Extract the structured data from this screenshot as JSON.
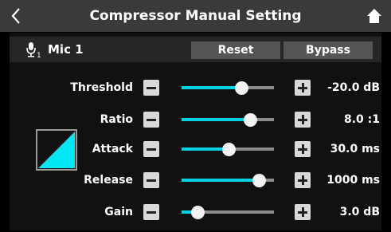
{
  "header": {
    "title": "Compressor Manual Setting",
    "back_icon": "chevron-left-icon",
    "home_icon": "home-icon"
  },
  "channel": {
    "icon": "microphone-icon",
    "subscript": "1",
    "label": "Mic 1"
  },
  "buttons": {
    "reset_label": "Reset",
    "bypass_label": "Bypass"
  },
  "curve_icon": "compressor-curve-icon",
  "accent_color": "#00d1e0",
  "params": [
    {
      "label": "Threshold",
      "value": "-20.0 dB",
      "level": 0.65
    },
    {
      "label": "Ratio",
      "value": "8.0 :1",
      "level": 0.74
    },
    {
      "label": "Attack",
      "value": "30.0 ms",
      "level": 0.51
    },
    {
      "label": "Release",
      "value": "1000 ms",
      "level": 0.84
    },
    {
      "label": "Gain",
      "value": "3.0 dB",
      "level": 0.17
    }
  ]
}
